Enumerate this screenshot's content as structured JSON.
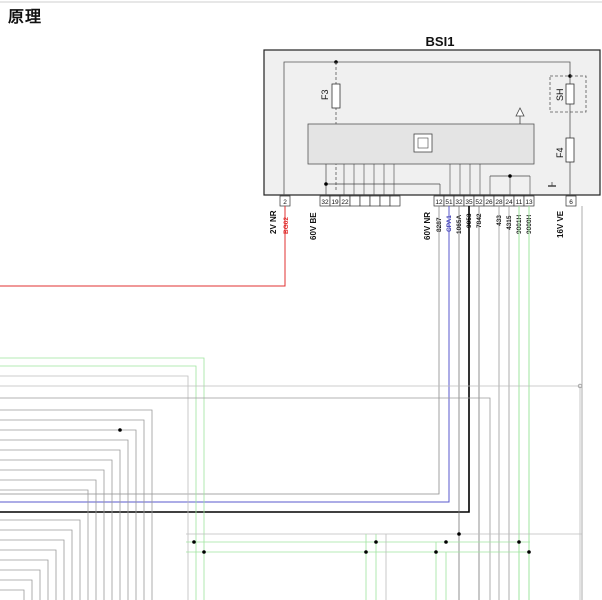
{
  "page": {
    "title": "原理"
  },
  "module": {
    "name": "BSI1",
    "fuse_left": "F3",
    "fuse_right": "F4",
    "shunt": "SH"
  },
  "connectors": {
    "c1": {
      "label": "2V NR"
    },
    "c2": {
      "label": "60V BE"
    },
    "c3": {
      "label": "60V NR"
    },
    "c4": {
      "label": "16V VE"
    }
  },
  "pins": {
    "c1": [
      "2"
    ],
    "c2": [
      "32",
      "19",
      "22"
    ],
    "c3": [
      "12",
      "51",
      "32",
      "35",
      "52",
      "26",
      "28",
      "24",
      "11",
      "13"
    ],
    "c4": [
      "6"
    ]
  },
  "wires": {
    "w1": "BG02",
    "w2": "8287",
    "w3": "CPA1",
    "w4": "1065A",
    "w5": "9053",
    "w6": "7842",
    "w7": "433",
    "w8": "4315",
    "w9": "9001H",
    "w10": "9000H"
  },
  "colors": {
    "red_wire": "#e03030",
    "blue_wire": "#5a5acc",
    "green_wire": "#9fe59f",
    "gray_wire": "#9a9a9a",
    "black_wire": "#000000"
  }
}
